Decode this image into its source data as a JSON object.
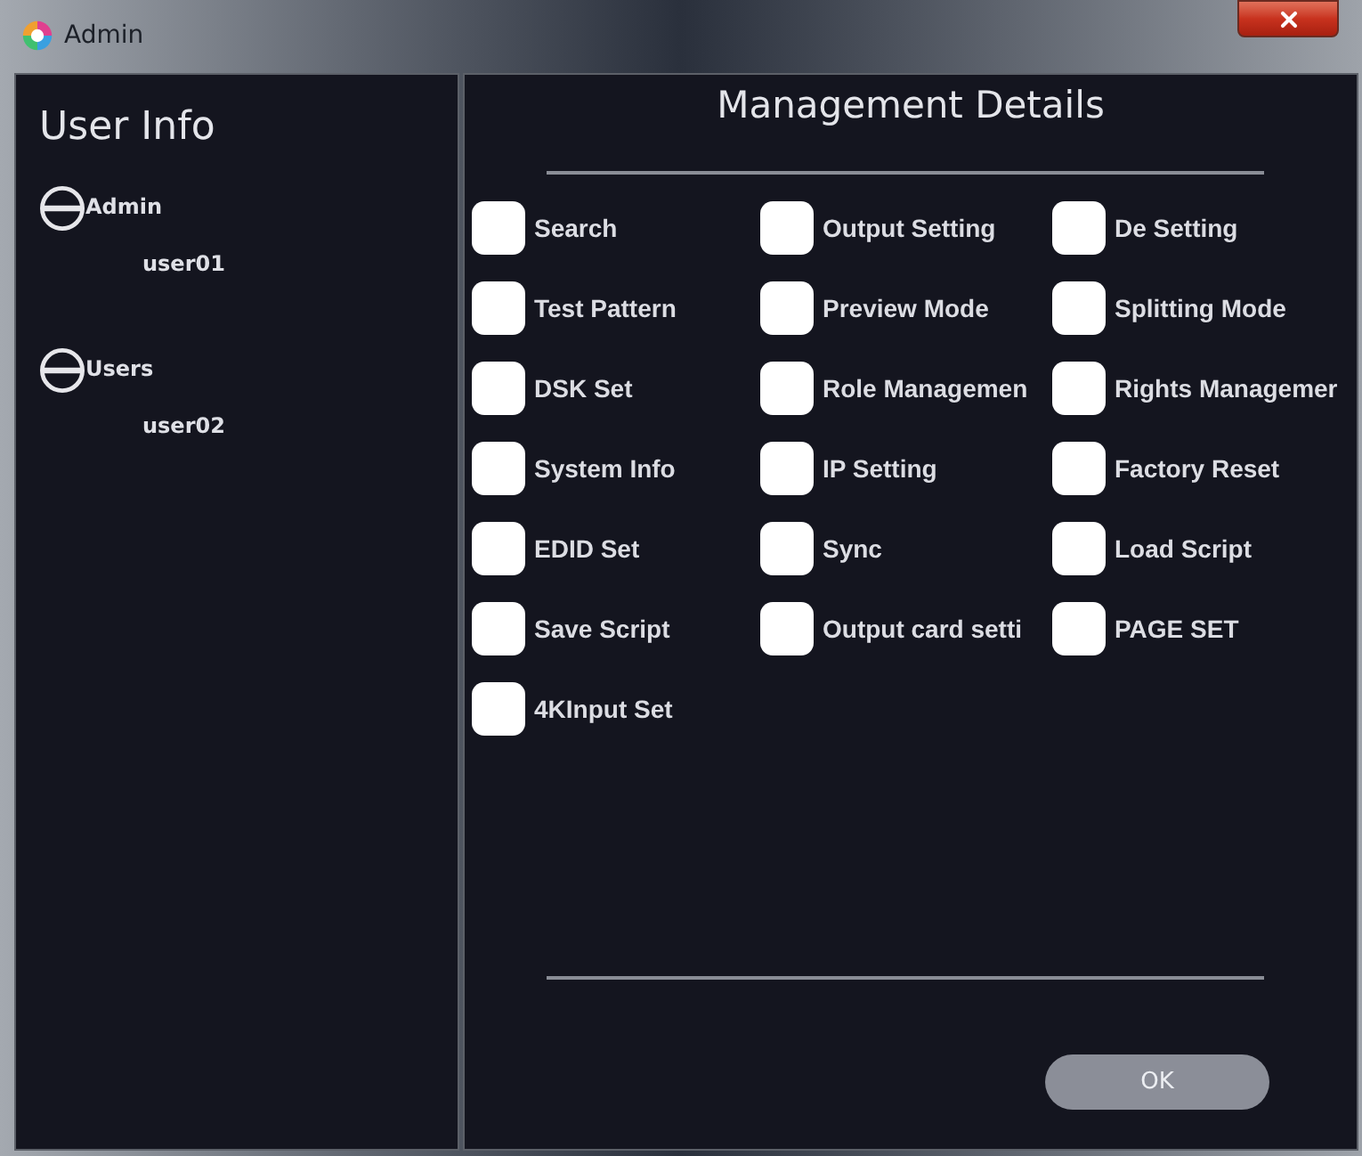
{
  "window": {
    "title": "Admin"
  },
  "user_info": {
    "title": "User Info",
    "groups": [
      {
        "label": "Admin",
        "expanded": true,
        "children": [
          {
            "label": "user01"
          }
        ]
      },
      {
        "label": "Users",
        "expanded": true,
        "children": [
          {
            "label": "user02"
          }
        ]
      }
    ]
  },
  "management": {
    "title": "Management Details",
    "permissions": [
      {
        "label": "Search",
        "checked": false
      },
      {
        "label": "Output Setting",
        "checked": false
      },
      {
        "label": "De Setting",
        "checked": false
      },
      {
        "label": "Test Pattern",
        "checked": false
      },
      {
        "label": "Preview Mode",
        "checked": false
      },
      {
        "label": "Splitting Mode",
        "checked": false
      },
      {
        "label": "DSK Set",
        "checked": false
      },
      {
        "label": "Role Managemen",
        "checked": false
      },
      {
        "label": "Rights Managemer",
        "checked": false
      },
      {
        "label": "System Info",
        "checked": false
      },
      {
        "label": "IP Setting",
        "checked": false
      },
      {
        "label": "Factory Reset",
        "checked": false
      },
      {
        "label": "EDID Set",
        "checked": false
      },
      {
        "label": "Sync",
        "checked": false
      },
      {
        "label": "Load Script",
        "checked": false
      },
      {
        "label": "Save Script",
        "checked": false
      },
      {
        "label": "Output card setti",
        "checked": false
      },
      {
        "label": "PAGE SET",
        "checked": false
      },
      {
        "label": "4KInput Set",
        "checked": false
      }
    ]
  },
  "buttons": [
    {
      "label": "OK"
    }
  ]
}
